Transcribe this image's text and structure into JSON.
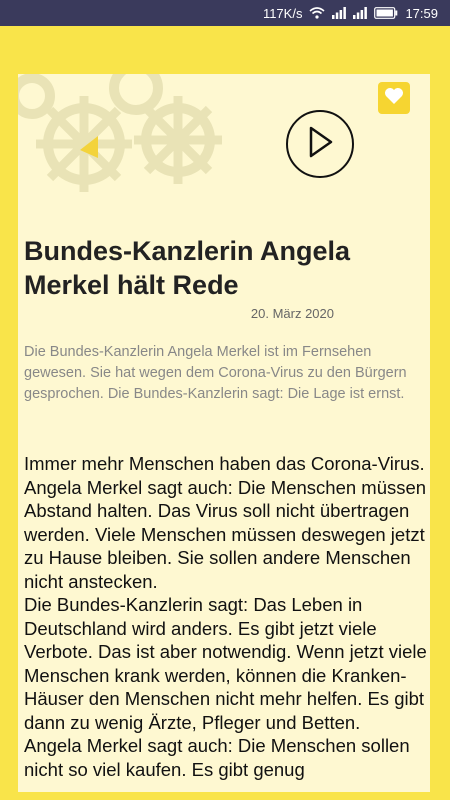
{
  "status_bar": {
    "speed": "117K/s",
    "time": "17:59",
    "icons": [
      "wifi-icon",
      "signal-icon",
      "signal-icon",
      "battery-icon"
    ]
  },
  "toolbar": {
    "favorite_icon": "heart-icon",
    "play_icon": "play-icon",
    "header_image": "gears-illustration"
  },
  "article": {
    "title": "Bundes-Kanzlerin Angela Merkel hält Rede",
    "date": "20. März 2020",
    "summary": "Die Bundes-Kanzlerin Angela Merkel ist im Fernsehen gewesen. Sie hat wegen dem Corona-Virus zu den Bürgern gesprochen. Die Bundes-Kanzlerin sagt: Die Lage ist ernst.",
    "paragraphs": [
      "Immer mehr Menschen haben das Corona-Virus. Angela Merkel sagt auch: Die Menschen müssen Abstand halten. Das Virus soll nicht übertragen werden. Viele Menschen müssen deswegen jetzt zu Hause bleiben. Sie sollen andere Menschen nicht anstecken.",
      "Die Bundes-Kanzlerin sagt: Das Leben in Deutschland wird anders. Es gibt jetzt viele Verbote. Das ist aber notwendig. Wenn jetzt viele Menschen krank werden, können die Kranken-Häuser den Menschen nicht mehr helfen. Es gibt dann zu wenig Ärzte, Pfleger und Betten.",
      "Angela Merkel sagt auch: Die Menschen sollen nicht so viel kaufen. Es gibt genug"
    ]
  },
  "colors": {
    "frame": "#f9e44a",
    "card": "#fef8d1",
    "status_bar": "#3a3a5c",
    "favorite": "#f6d531"
  }
}
